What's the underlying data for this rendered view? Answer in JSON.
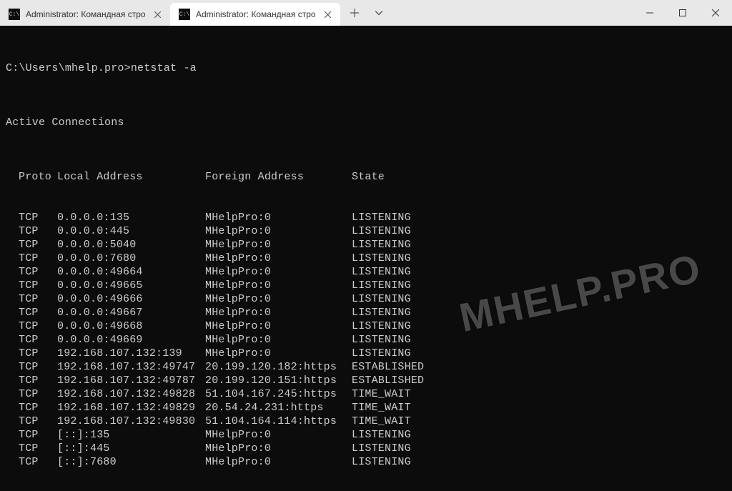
{
  "tabs": [
    {
      "title": "Administrator: Командная стро",
      "active": false
    },
    {
      "title": "Administrator: Командная стро",
      "active": true
    }
  ],
  "terminal": {
    "prompt": "C:\\Users\\mhelp.pro>",
    "command": "netstat -a",
    "section_title": "Active Connections",
    "headers": {
      "proto": "Proto",
      "local": "Local Address",
      "foreign": "Foreign Address",
      "state": "State"
    },
    "rows": [
      {
        "proto": "TCP",
        "local": "0.0.0.0:135",
        "foreign": "MHelpPro:0",
        "state": "LISTENING"
      },
      {
        "proto": "TCP",
        "local": "0.0.0.0:445",
        "foreign": "MHelpPro:0",
        "state": "LISTENING"
      },
      {
        "proto": "TCP",
        "local": "0.0.0.0:5040",
        "foreign": "MHelpPro:0",
        "state": "LISTENING"
      },
      {
        "proto": "TCP",
        "local": "0.0.0.0:7680",
        "foreign": "MHelpPro:0",
        "state": "LISTENING"
      },
      {
        "proto": "TCP",
        "local": "0.0.0.0:49664",
        "foreign": "MHelpPro:0",
        "state": "LISTENING"
      },
      {
        "proto": "TCP",
        "local": "0.0.0.0:49665",
        "foreign": "MHelpPro:0",
        "state": "LISTENING"
      },
      {
        "proto": "TCP",
        "local": "0.0.0.0:49666",
        "foreign": "MHelpPro:0",
        "state": "LISTENING"
      },
      {
        "proto": "TCP",
        "local": "0.0.0.0:49667",
        "foreign": "MHelpPro:0",
        "state": "LISTENING"
      },
      {
        "proto": "TCP",
        "local": "0.0.0.0:49668",
        "foreign": "MHelpPro:0",
        "state": "LISTENING"
      },
      {
        "proto": "TCP",
        "local": "0.0.0.0:49669",
        "foreign": "MHelpPro:0",
        "state": "LISTENING"
      },
      {
        "proto": "TCP",
        "local": "192.168.107.132:139",
        "foreign": "MHelpPro:0",
        "state": "LISTENING"
      },
      {
        "proto": "TCP",
        "local": "192.168.107.132:49747",
        "foreign": "20.199.120.182:https",
        "state": "ESTABLISHED"
      },
      {
        "proto": "TCP",
        "local": "192.168.107.132:49787",
        "foreign": "20.199.120.151:https",
        "state": "ESTABLISHED"
      },
      {
        "proto": "TCP",
        "local": "192.168.107.132:49828",
        "foreign": "51.104.167.245:https",
        "state": "TIME_WAIT"
      },
      {
        "proto": "TCP",
        "local": "192.168.107.132:49829",
        "foreign": "20.54.24.231:https",
        "state": "TIME_WAIT"
      },
      {
        "proto": "TCP",
        "local": "192.168.107.132:49830",
        "foreign": "51.104.164.114:https",
        "state": "TIME_WAIT"
      },
      {
        "proto": "TCP",
        "local": "[::]:135",
        "foreign": "MHelpPro:0",
        "state": "LISTENING"
      },
      {
        "proto": "TCP",
        "local": "[::]:445",
        "foreign": "MHelpPro:0",
        "state": "LISTENING"
      },
      {
        "proto": "TCP",
        "local": "[::]:7680",
        "foreign": "MHelpPro:0",
        "state": "LISTENING"
      }
    ]
  },
  "watermark": "MHELP.PRO"
}
